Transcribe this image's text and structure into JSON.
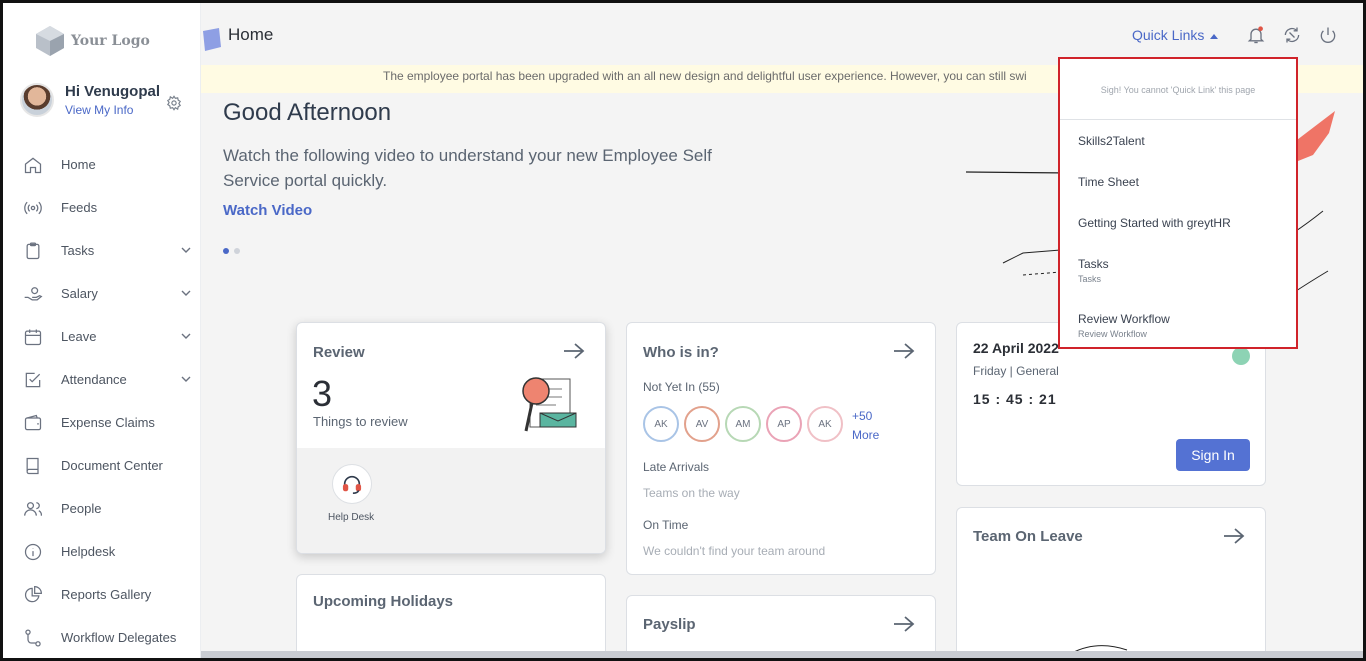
{
  "app": {
    "logo_text": "Your Logo",
    "breadcrumb": "Home",
    "quick_links_label": "Quick Links"
  },
  "user": {
    "greeting": "Hi Venugopal",
    "view_info": "View My Info"
  },
  "sidebar": {
    "items": [
      {
        "label": "Home",
        "icon": "home-icon",
        "expandable": false
      },
      {
        "label": "Feeds",
        "icon": "feeds-icon",
        "expandable": false
      },
      {
        "label": "Tasks",
        "icon": "clipboard-icon",
        "expandable": true
      },
      {
        "label": "Salary",
        "icon": "salary-hand-icon",
        "expandable": true
      },
      {
        "label": "Leave",
        "icon": "calendar-icon",
        "expandable": true
      },
      {
        "label": "Attendance",
        "icon": "attendance-check-icon",
        "expandable": true
      },
      {
        "label": "Expense Claims",
        "icon": "wallet-icon",
        "expandable": false
      },
      {
        "label": "Document Center",
        "icon": "book-icon",
        "expandable": false
      },
      {
        "label": "People",
        "icon": "people-icon",
        "expandable": false
      },
      {
        "label": "Helpdesk",
        "icon": "info-icon",
        "expandable": false
      },
      {
        "label": "Reports Gallery",
        "icon": "pie-chart-icon",
        "expandable": false
      },
      {
        "label": "Workflow Delegates",
        "icon": "workflow-icon",
        "expandable": false
      }
    ]
  },
  "banner": {
    "text": "The employee portal has been upgraded with an all new design and delightful user experience. However, you can still swi"
  },
  "hero": {
    "greeting": "Good Afternoon",
    "subtitle": "Watch the following video to understand your new Employee Self Service portal quickly.",
    "watch_link": "Watch Video",
    "carousel_active_index": 0,
    "carousel_count": 2
  },
  "review_card": {
    "title": "Review",
    "count": "3",
    "caption": "Things to review",
    "help_label": "Help Desk"
  },
  "who_card": {
    "title": "Who is in?",
    "not_yet_in_label": "Not Yet In",
    "not_yet_in_count": "(55)",
    "avatars": [
      {
        "initials": "AK",
        "color": "#a9c4e6"
      },
      {
        "initials": "AV",
        "color": "#e2a18c"
      },
      {
        "initials": "AM",
        "color": "#b7d8b5"
      },
      {
        "initials": "AP",
        "color": "#eaa3b6"
      },
      {
        "initials": "AK",
        "color": "#f0c0c6"
      }
    ],
    "more_count": "+50",
    "more_label": "More",
    "late_label": "Late Arrivals",
    "late_note": "Teams on the way",
    "ontime_label": "On Time",
    "ontime_note": "We couldn't find your team around"
  },
  "attendance_card": {
    "date": "22 April 2022",
    "shift": "Friday | General",
    "time": "15 : 45 : 21",
    "button": "Sign In"
  },
  "holidays_card": {
    "title": "Upcoming Holidays"
  },
  "payslip_card": {
    "title": "Payslip"
  },
  "leave_card": {
    "title": "Team On Leave"
  },
  "quick_links": {
    "note": "Sigh! You cannot 'Quick Link' this page",
    "items": [
      {
        "label": "Skills2Talent",
        "sub": ""
      },
      {
        "label": "Time Sheet",
        "sub": ""
      },
      {
        "label": "Getting Started with greytHR",
        "sub": ""
      },
      {
        "label": "Tasks",
        "sub": "Tasks"
      },
      {
        "label": "Review Workflow",
        "sub": "Review Workflow"
      }
    ]
  },
  "colors": {
    "accent": "#4a68c7",
    "button": "#5472d3",
    "dropdown_border": "#d0232a",
    "banner_bg": "#fffbe3"
  }
}
